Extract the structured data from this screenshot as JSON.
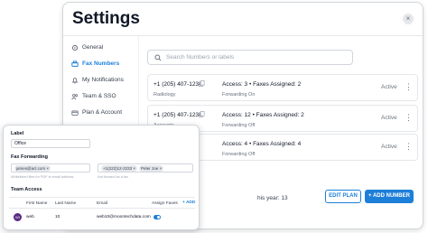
{
  "window": {
    "title": "Settings",
    "close_glyph": "×"
  },
  "sidebar": {
    "items": [
      {
        "label": "General",
        "icon": "gear-icon"
      },
      {
        "label": "Fax Numbers",
        "icon": "fax-icon",
        "active": true
      },
      {
        "label": "My Notifications",
        "icon": "bell-icon"
      },
      {
        "label": "Team & SSO",
        "icon": "team-icon"
      },
      {
        "label": "Plan & Account",
        "icon": "card-icon"
      }
    ]
  },
  "search": {
    "placeholder": "Search Numbers or labels"
  },
  "rows": [
    {
      "number": "+1 (205) 407-1234",
      "label": "Radiology",
      "access": "Access: 3 • Faxes Assigned: 2",
      "forwarding": "Forwarding On",
      "status": "Active"
    },
    {
      "number": "+1 (205) 407-1234",
      "label": "Accounts",
      "access": "Access: 12 • Faxes Assigned: 2",
      "forwarding": "Forwarding Off",
      "status": "Active"
    },
    {
      "number": "",
      "label": "",
      "access": "Access: 4 • Faxes Assigned: 4",
      "forwarding": "Forwarding Off",
      "status": "Active"
    }
  ],
  "footer": {
    "faxes_year_label": "his year:",
    "faxes_year_value": "13",
    "edit_plan": "EDIT PLAN",
    "add_number": "+ ADD NUMBER"
  },
  "popup": {
    "label_heading": "Label",
    "label_value": "Office",
    "fax_forwarding_heading": "Fax Forwarding",
    "email_chip": "james@acl.com ×",
    "email_help": "Whitelisted files for PDF to email address",
    "number_chip": "+1(222)12-2233 ×",
    "name_chip": "Peter Joe ×",
    "number_help": "Not forward as a fax",
    "team_access_heading": "Team Access",
    "columns": [
      "First Name",
      "Last Name",
      "Email",
      "Assign Faxes"
    ],
    "add_label": "+ ADD",
    "member": {
      "initials": "WI",
      "first_name": "web",
      "last_name": "10",
      "email": "web10@moontechdata.com",
      "assign_faxes": true
    }
  },
  "colors": {
    "accent": "#1d7fd8",
    "avatar": "#5b2a86"
  }
}
